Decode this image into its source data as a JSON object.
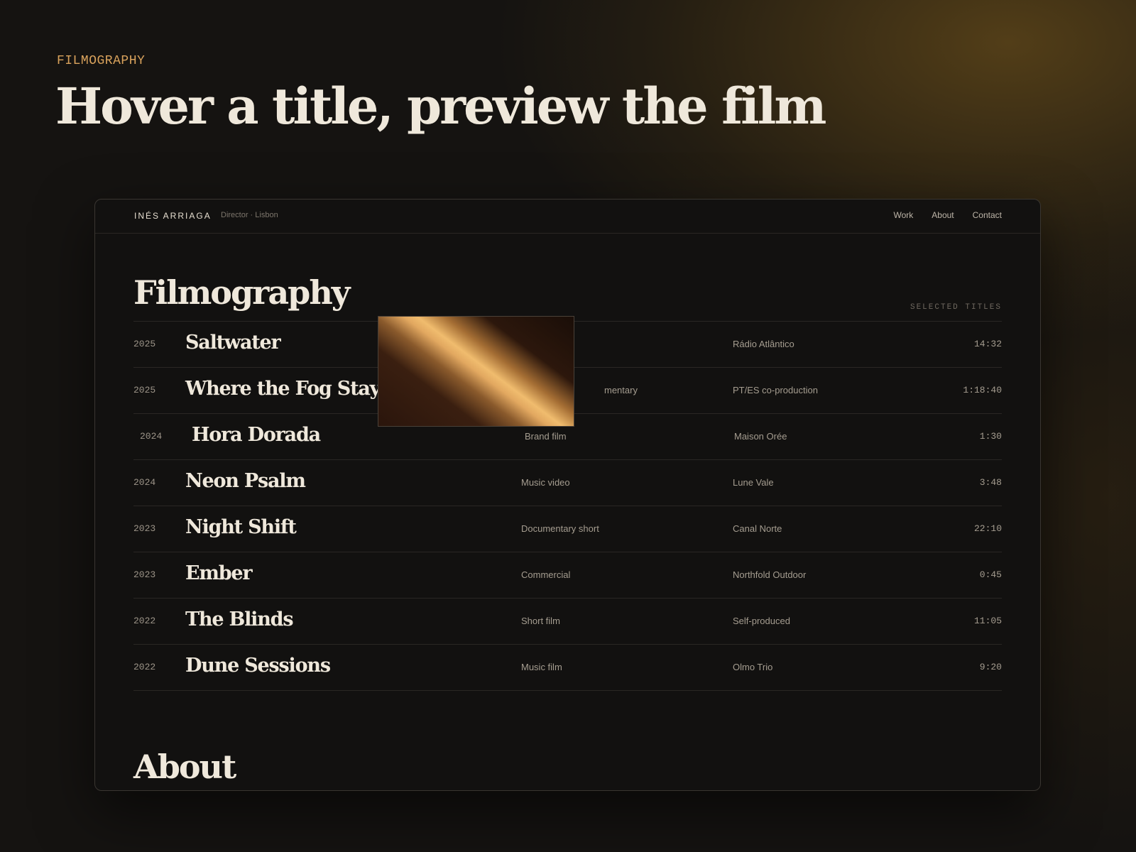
{
  "page": {
    "eyebrow": "FILMOGRAPHY",
    "headline": "Hover a title, preview the film"
  },
  "site": {
    "brand_name": "INÉS ARRIAGA",
    "brand_sub": "Director · Lisbon",
    "nav": [
      "Work",
      "About",
      "Contact"
    ]
  },
  "filmography": {
    "title": "Filmography",
    "tag": "SELECTED TITLES",
    "rows": [
      {
        "year": "2025",
        "title": "Saltwater",
        "kind": "",
        "client": "Rádio Atlântico",
        "duration": "14:32"
      },
      {
        "year": "2025",
        "title": "Where the Fog Stays",
        "kind": "mentary",
        "client": "PT/ES co-production",
        "duration": "1:18:40"
      },
      {
        "year": "2024",
        "title": "Hora Dorada",
        "kind": "Brand film",
        "client": "Maison Orée",
        "duration": "1:30"
      },
      {
        "year": "2024",
        "title": "Neon Psalm",
        "kind": "Music video",
        "client": "Lune Vale",
        "duration": "3:48"
      },
      {
        "year": "2023",
        "title": "Night Shift",
        "kind": "Documentary short",
        "client": "Canal Norte",
        "duration": "22:10"
      },
      {
        "year": "2023",
        "title": "Ember",
        "kind": "Commercial",
        "client": "Northfold Outdoor",
        "duration": "0:45"
      },
      {
        "year": "2022",
        "title": "The Blinds",
        "kind": "Short film",
        "client": "Self-produced",
        "duration": "11:05"
      },
      {
        "year": "2022",
        "title": "Dune Sessions",
        "kind": "Music film",
        "client": "Olmo Trio",
        "duration": "9:20"
      }
    ]
  },
  "about": {
    "title": "About"
  },
  "colors": {
    "accent": "#d9a25c",
    "background": "#151311",
    "panel": "#121110",
    "text": "#efe8db"
  }
}
